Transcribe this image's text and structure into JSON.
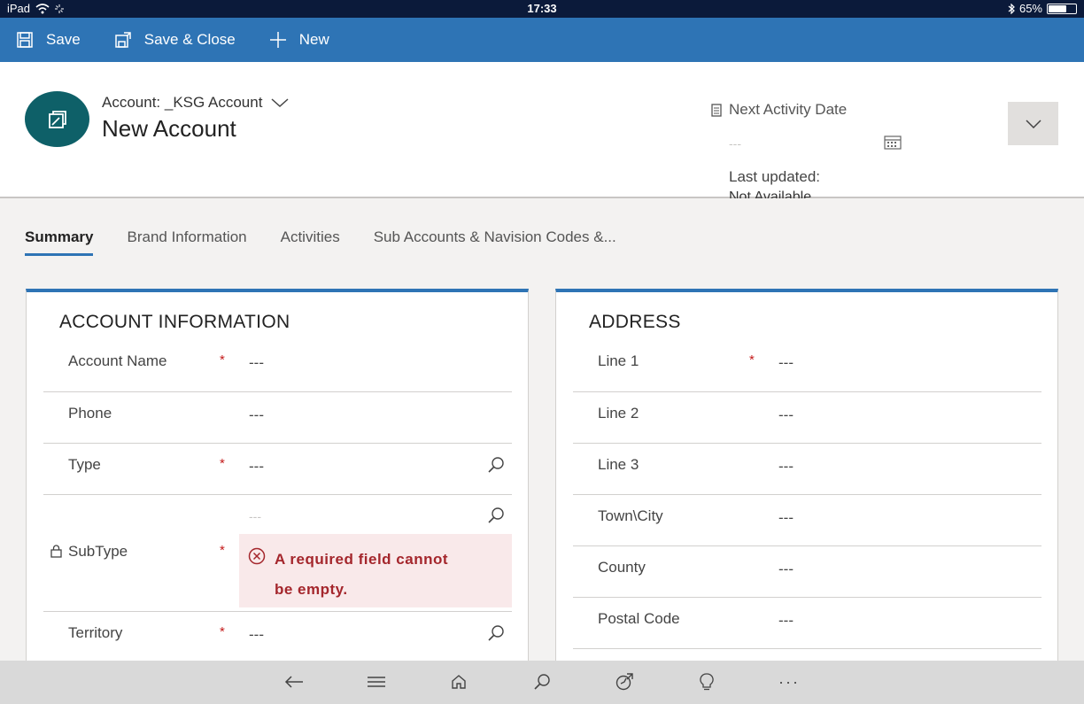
{
  "status_bar": {
    "device": "iPad",
    "time": "17:33",
    "battery": "65%",
    "battery_level": 0.65
  },
  "command_bar": {
    "save": "Save",
    "save_close": "Save & Close",
    "new": "New"
  },
  "header": {
    "entity_line": "Account: _KSG Account",
    "record_title": "New Account",
    "next_activity_label": "Next Activity Date",
    "next_activity_value": "---",
    "last_updated_label": "Last updated:",
    "last_updated_value": "Not Available"
  },
  "tabs": [
    "Summary",
    "Brand Information",
    "Activities",
    "Sub Accounts & Navision Codes &..."
  ],
  "account_info": {
    "title": "ACCOUNT INFORMATION",
    "fields": [
      {
        "label": "Account Name",
        "value": "---",
        "required": "*"
      },
      {
        "label": "Phone",
        "value": "---",
        "required": ""
      },
      {
        "label": "Type",
        "value": "---",
        "required": "*"
      },
      {
        "label": "SubType",
        "value": "---",
        "required": "*"
      },
      {
        "label": "Territory",
        "value": "---",
        "required": "*"
      }
    ],
    "error_line1": "A required field cannot",
    "error_line2": "be empty."
  },
  "address": {
    "title": "ADDRESS",
    "fields": [
      {
        "label": "Line 1",
        "value": "---",
        "required": "*"
      },
      {
        "label": "Line 2",
        "value": "---",
        "required": ""
      },
      {
        "label": "Line 3",
        "value": "---",
        "required": ""
      },
      {
        "label": "Town\\City",
        "value": "---",
        "required": ""
      },
      {
        "label": "County",
        "value": "---",
        "required": ""
      },
      {
        "label": "Postal Code",
        "value": "---",
        "required": ""
      }
    ]
  },
  "bottom_nav": {
    "more": "···"
  },
  "colors": {
    "brand_blue": "#2e74b5",
    "avatar_teal": "#0e6068",
    "required_red": "#c41a1a",
    "error_bg": "#f9e9ea"
  }
}
